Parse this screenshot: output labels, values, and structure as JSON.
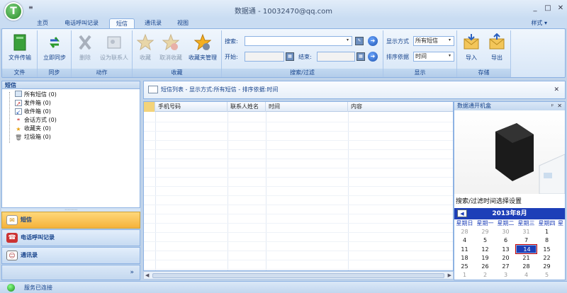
{
  "app": {
    "title": "数据通 - 10032470@qq.com",
    "logo_letter": "T",
    "qat": "≡"
  },
  "window_controls": {
    "minimize": "_",
    "maximize": "□",
    "close": "✕"
  },
  "tabs": [
    "主页",
    "电话呼叫记录",
    "短信",
    "通讯录",
    "视图"
  ],
  "active_tab": "短信",
  "style_menu": "样式 ▾",
  "ribbon": {
    "file": {
      "group_label": "文件",
      "buttons": [
        "文件传输"
      ]
    },
    "sync": {
      "group_label": "同步",
      "buttons": [
        "立即同步"
      ]
    },
    "action": {
      "group_label": "动作",
      "buttons": [
        "删除",
        "设为联系人"
      ]
    },
    "favorites": {
      "group_label": "收藏",
      "buttons": [
        "收藏",
        "取消收藏",
        "收藏夹管理"
      ]
    },
    "search_filter": {
      "group_label": "搜索/过滤",
      "search_label": "搜索:",
      "start_label": "开始:",
      "end_label": "结束:",
      "search_value": "",
      "start_value": "",
      "end_value": ""
    },
    "display": {
      "group_label": "显示",
      "mode_label": "显示方式",
      "mode_value": "所有短信",
      "sort_label": "排序依据",
      "sort_value": "时间"
    },
    "storage": {
      "group_label": "存储",
      "buttons": [
        "导入",
        "导出"
      ]
    }
  },
  "left_panel": {
    "header": "短信",
    "tree": [
      {
        "label": "所有短信 (0)",
        "icon": "all-messages-icon"
      },
      {
        "label": "发件箱 (0)",
        "icon": "outbox-icon"
      },
      {
        "label": "收件箱 (0)",
        "icon": "inbox-icon"
      },
      {
        "label": "会话方式 (0)",
        "icon": "conversation-icon"
      },
      {
        "label": "收藏夹 (0)",
        "icon": "star-icon"
      },
      {
        "label": "垃圾箱 (0)",
        "icon": "trash-icon"
      }
    ],
    "nav": [
      {
        "label": "短信",
        "active": true
      },
      {
        "label": "电话呼叫记录",
        "active": false
      },
      {
        "label": "通讯录",
        "active": false
      }
    ],
    "nav_footer": "»"
  },
  "list": {
    "header": "短信列表 - 显示方式:所有短信 - 排序依据:时间",
    "close": "✕",
    "columns": [
      "手机号码",
      "联系人姓名",
      "时间",
      "内容"
    ]
  },
  "right_panel": {
    "title": "数据通开机盒",
    "pin": "ᵖ",
    "close": "✕",
    "filter_title": "搜索/过滤时间选择设置",
    "calendar": {
      "month_label": "2013年8月",
      "prev": "◀",
      "weekdays": [
        "星期日",
        "星期一",
        "星期二",
        "星期三",
        "星期四",
        "星"
      ],
      "rows": [
        [
          "28",
          "29",
          "30",
          "31",
          "1"
        ],
        [
          "4",
          "5",
          "6",
          "7",
          "8"
        ],
        [
          "11",
          "12",
          "13",
          "14",
          "15"
        ],
        [
          "18",
          "19",
          "20",
          "21",
          "22"
        ],
        [
          "25",
          "26",
          "27",
          "28",
          "29"
        ],
        [
          "1",
          "2",
          "3",
          "4",
          "5"
        ]
      ],
      "selected": "14"
    }
  },
  "status": {
    "text": "服务已连接",
    "color": "#1a8a1a"
  }
}
